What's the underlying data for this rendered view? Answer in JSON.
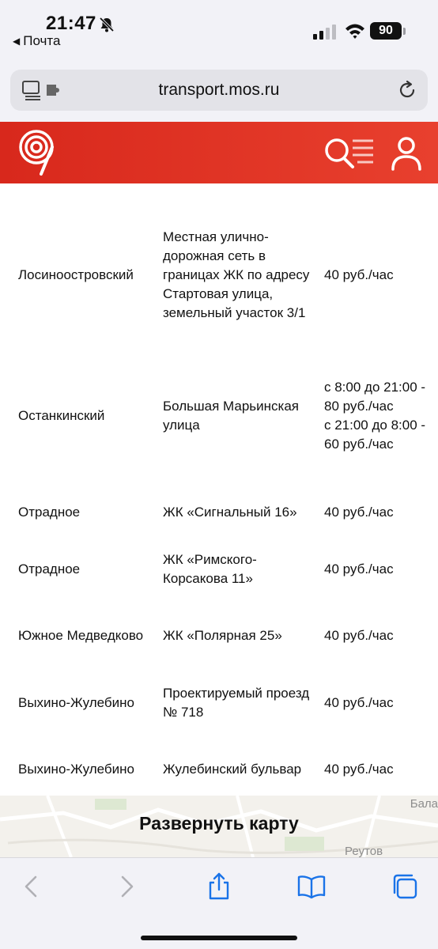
{
  "status_bar": {
    "time": "21:47",
    "back_app": "Почта",
    "battery": "90"
  },
  "address_bar": {
    "url": "transport.mos.ru"
  },
  "table": {
    "rows": [
      {
        "district": "Лосиноостровский",
        "address": "Местная улично-дорожная сеть в границах ЖК по адресу Стартовая улица, земельный участок 3/1",
        "price": "40 руб./час"
      },
      {
        "district": "Останкинский",
        "address": "Большая Марьинская улица",
        "price": "с 8:00 до 21:00 - 80 руб./час\nс 21:00 до 8:00 - 60 руб./час"
      },
      {
        "district": "Отрадное",
        "address": "ЖК «Сигнальный 16»",
        "price": "40 руб./час"
      },
      {
        "district": "Отрадное",
        "address": "ЖК «Римского-Корсакова 11»",
        "price": "40 руб./час"
      },
      {
        "district": "Южное Медведково",
        "address": "ЖК «Полярная 25»",
        "price": "40 руб./час"
      },
      {
        "district": "Выхино-Жулебино",
        "address": "Проектируемый проезд № 718",
        "price": "40 руб./час"
      },
      {
        "district": "Выхино-Жулебино",
        "address": "Жулебинский бульвар",
        "price": "40 руб./час"
      }
    ]
  },
  "map": {
    "expand_label": "Развернуть карту",
    "labels": [
      "Бала",
      "Реутов"
    ]
  },
  "colors": {
    "brand_red": "#d8281c",
    "ios_blue": "#1a73e8"
  }
}
